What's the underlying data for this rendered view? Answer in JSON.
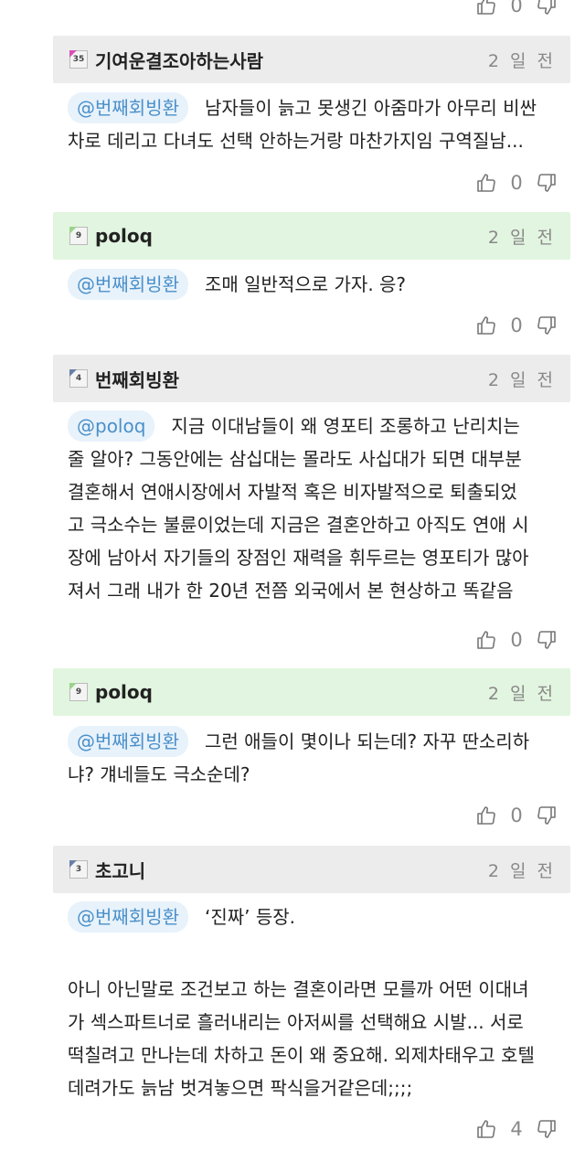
{
  "comments": [
    {
      "user": "기여운결조아하는사람",
      "level": "35",
      "tag_color": "#d94fb8",
      "header": "gray",
      "time": "2 일 전",
      "mention": "@번째회빙환",
      "text": "남자들이 늙고 못생긴 아줌마가 아무리 비싼\n차로 데리고 다녀도 선택 안하는거랑 마찬가지임 구역질남...",
      "text2": "",
      "likes": "0"
    },
    {
      "user": "poloq",
      "level": "9",
      "tag_color": "#9ad48b",
      "header": "green",
      "time": "2 일 전",
      "mention": "@번째회빙환",
      "text": "조매 일반적으로 가자. 응?",
      "text2": "",
      "likes": "0"
    },
    {
      "user": "번째회빙환",
      "level": "4",
      "tag_color": "#6a7fa8",
      "header": "gray",
      "time": "2 일 전",
      "mention": "@poloq",
      "text": "지금 이대남들이 왜 영포티 조롱하고 난리치는\n줄 알아? 그동안에는 삼십대는 몰라도 사십대가 되면 대부분\n결혼해서 연애시장에서 자발적 혹은 비자발적으로 퇴출되었\n고 극소수는 불륜이었는데 지금은 결혼안하고 아직도 연애 시\n장에 남아서 자기들의 장점인 재력을 휘두르는 영포티가 많아\n져서 그래 내가 한 20년 전쯤 외국에서 본 현상하고 똑같음",
      "text2": "",
      "likes": "0"
    },
    {
      "user": "poloq",
      "level": "9",
      "tag_color": "#9ad48b",
      "header": "green",
      "time": "2 일 전",
      "mention": "@번째회빙환",
      "text": "그런 애들이 몇이나 되는데? 자꾸 딴소리하\n냐? 걔네들도 극소순데?",
      "text2": "",
      "likes": "0"
    },
    {
      "user": "초고니",
      "level": "3",
      "tag_color": "#6a7fa8",
      "header": "gray",
      "time": "2 일 전",
      "mention": "@번째회빙환",
      "text": "‘진짜’ 등장.",
      "text2": "아니 아닌말로 조건보고 하는 결혼이라면 모를까 어떤 이대녀\n가 섹스파트너로 흘러내리는 아저씨를 선택해요 시발... 서로\n떡칠려고 만나는데 차하고 돈이 왜 중요해. 외제차태우고 호텔\n데려가도 늙남 벗겨놓으면 팍식을거같은데;;;;",
      "likes": "4"
    }
  ],
  "top_likes": "0"
}
